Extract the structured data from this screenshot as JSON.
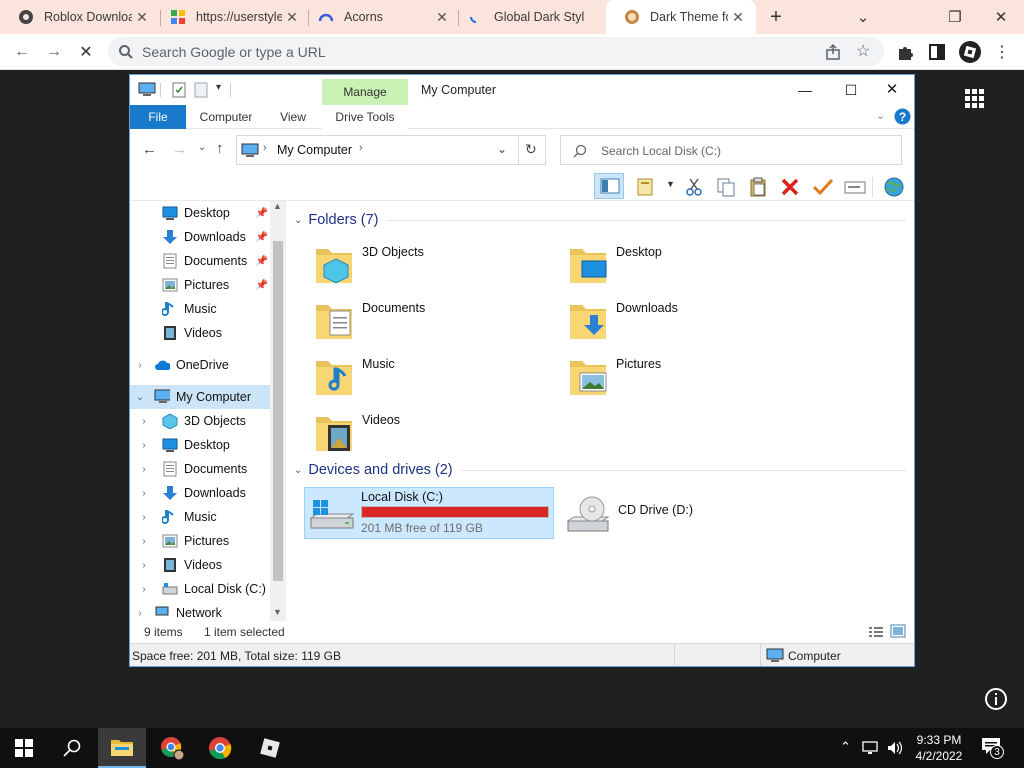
{
  "browser": {
    "tabs": [
      {
        "title": "Roblox Downloa",
        "active": false
      },
      {
        "title": "https://userstyle",
        "active": false
      },
      {
        "title": "Acorns",
        "active": false
      },
      {
        "title": "Global Dark Styl",
        "active": false
      },
      {
        "title": "Dark Theme for",
        "active": true
      }
    ],
    "omnibox_placeholder": "Search Google or type a URL"
  },
  "explorer": {
    "title": "My Computer",
    "ribbon_tabs": {
      "file": "File",
      "computer": "Computer",
      "view": "View",
      "manage": "Manage",
      "drive_tools": "Drive Tools"
    },
    "address": "My Computer",
    "search_placeholder": "Search Local Disk (C:)",
    "nav": {
      "quick": [
        {
          "label": "Desktop",
          "pinned": true
        },
        {
          "label": "Downloads",
          "pinned": true
        },
        {
          "label": "Documents",
          "pinned": true
        },
        {
          "label": "Pictures",
          "pinned": true
        },
        {
          "label": "Music",
          "pinned": false
        },
        {
          "label": "Videos",
          "pinned": false
        }
      ],
      "onedrive": "OneDrive",
      "mycomputer": "My Computer",
      "children": [
        "3D Objects",
        "Desktop",
        "Documents",
        "Downloads",
        "Music",
        "Pictures",
        "Videos",
        "Local Disk (C:)"
      ],
      "network": "Network"
    },
    "folders_header": "Folders (7)",
    "folders": [
      "3D Objects",
      "Desktop",
      "Documents",
      "Downloads",
      "Music",
      "Pictures",
      "Videos"
    ],
    "drives_header": "Devices and drives (2)",
    "drives": [
      {
        "label": "Local Disk (C:)",
        "free_text": "201 MB free of 119 GB",
        "used_fraction": 0.998
      },
      {
        "label": "CD Drive (D:)"
      }
    ],
    "status": {
      "items": "9 items",
      "selected": "1 item selected"
    },
    "bottom": {
      "space": "Space free: 201 MB, Total size: 119 GB",
      "location": "Computer"
    }
  },
  "taskbar": {
    "time": "9:33 PM",
    "date": "4/2/2022",
    "notifications": "3"
  },
  "colors": {
    "accent": "#1979ca",
    "manage_tab": "#c9f1b4",
    "drive_bar": "#da2626",
    "selection": "#cce8ff"
  }
}
